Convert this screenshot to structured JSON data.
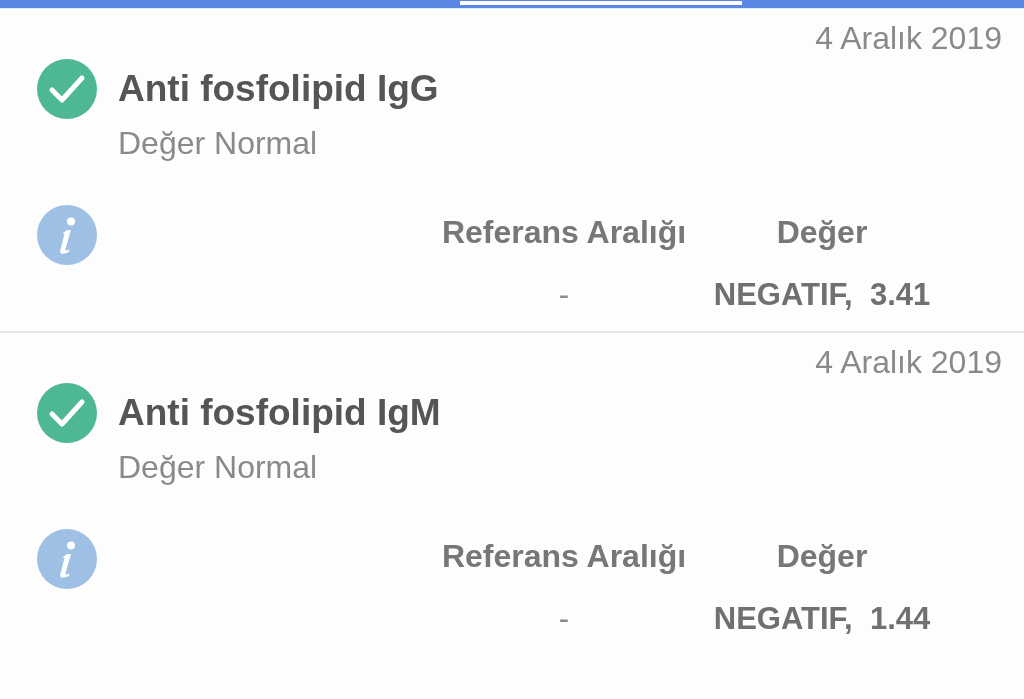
{
  "results": [
    {
      "date": "4 Aralık 2019",
      "normal": true,
      "name": "Anti fosfolipid IgG",
      "status_text": "Değer Normal",
      "columns": [
        "Referans Aralığı",
        "Değer"
      ],
      "reference_range": "-",
      "value": "NEGATIF,  3.41"
    },
    {
      "date": "4 Aralık 2019",
      "normal": true,
      "name": "Anti fosfolipid IgM",
      "status_text": "Değer Normal",
      "columns": [
        "Referans Aralığı",
        "Değer"
      ],
      "reference_range": "-",
      "value": "NEGATIF,  1.44"
    }
  ]
}
